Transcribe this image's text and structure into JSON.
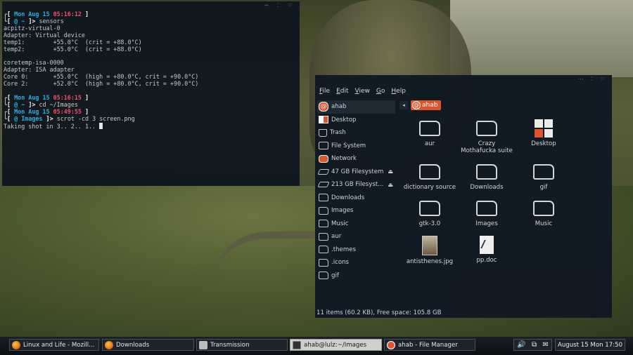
{
  "terminal": {
    "window_controls": "⋯ ⁚ ⁙",
    "prompt1_date": "Mon Aug 15",
    "prompt1_time": "05:16:12",
    "prompt1_path": "~",
    "cmd1": "sensors",
    "output1": [
      "acpitz-virtual-0",
      "Adapter: Virtual device",
      "temp1:        +55.0°C  (crit = +88.0°C)",
      "temp2:        +55.0°C  (crit = +88.0°C)",
      "",
      "coretemp-isa-0000",
      "Adapter: ISA adapter",
      "Core 0:       +55.0°C  (high = +80.0°C, crit = +90.0°C)",
      "Core 2:       +52.0°C  (high = +80.0°C, crit = +90.0°C)"
    ],
    "prompt2_date": "Mon Aug 15",
    "prompt2_time": "05:16:15",
    "prompt2_path": "~",
    "cmd2": "cd ~/Images",
    "prompt3_date": "Mon Aug 15",
    "prompt3_time": "05:49:55",
    "prompt3_path": "Images",
    "cmd3": "scrot -cd 3 screen.png",
    "output3": "Taking shot in 3.. 2.. 1.."
  },
  "file_manager": {
    "window_controls": "⋯ ⁚ ⁙",
    "menu": [
      "File",
      "Edit",
      "View",
      "Go",
      "Help"
    ],
    "sidebar": [
      {
        "label": "ahab",
        "icon": "home-icon",
        "selected": true
      },
      {
        "label": "Desktop",
        "icon": "desktop-icon"
      },
      {
        "label": "Trash",
        "icon": "trash-icon"
      },
      {
        "label": "File System",
        "icon": "filesystem-icon"
      },
      {
        "label": "Network",
        "icon": "network-icon"
      },
      {
        "label": "47 GB Filesystem",
        "icon": "drive-icon",
        "eject": true
      },
      {
        "label": "213 GB Filesyst...",
        "icon": "drive-icon",
        "eject": true
      },
      {
        "label": "Downloads",
        "icon": "folder-icon"
      },
      {
        "label": "Images",
        "icon": "folder-icon"
      },
      {
        "label": "Music",
        "icon": "folder-icon"
      },
      {
        "label": "aur",
        "icon": "folder-icon"
      },
      {
        "label": ".themes",
        "icon": "folder-icon"
      },
      {
        "label": ".icons",
        "icon": "folder-icon"
      },
      {
        "label": "gif",
        "icon": "folder-icon"
      }
    ],
    "path_button": "ahab",
    "files": [
      {
        "name": "aur",
        "type": "folder"
      },
      {
        "name": "Crazy Mothafucka suite",
        "type": "folder"
      },
      {
        "name": "Desktop",
        "type": "desktop"
      },
      {
        "name": "dictionary source",
        "type": "folder"
      },
      {
        "name": "Downloads",
        "type": "folder"
      },
      {
        "name": "gif",
        "type": "folder"
      },
      {
        "name": "gtk-3.0",
        "type": "folder"
      },
      {
        "name": "Images",
        "type": "folder"
      },
      {
        "name": "Music",
        "type": "folder"
      },
      {
        "name": "antisthenes.jpg",
        "type": "image"
      },
      {
        "name": "pp.doc",
        "type": "document"
      }
    ],
    "status": "11 items (60.2 KB), Free space: 105.8 GB"
  },
  "taskbar": {
    "tasks": [
      {
        "label": "Linux and Life - Mozill...",
        "icon": "firefox-icon"
      },
      {
        "label": "Downloads",
        "icon": "firefox-icon"
      },
      {
        "label": "Transmission",
        "icon": "transmission-icon"
      },
      {
        "label": "ahab@lulz:~/Images",
        "icon": "terminal-icon",
        "active": true
      },
      {
        "label": "ahab - File Manager",
        "icon": "file-manager-icon"
      }
    ],
    "tray_icons": [
      "volume-icon",
      "network-tray-icon",
      "mail-icon"
    ],
    "clock": "August 15 Mon  17:50"
  }
}
